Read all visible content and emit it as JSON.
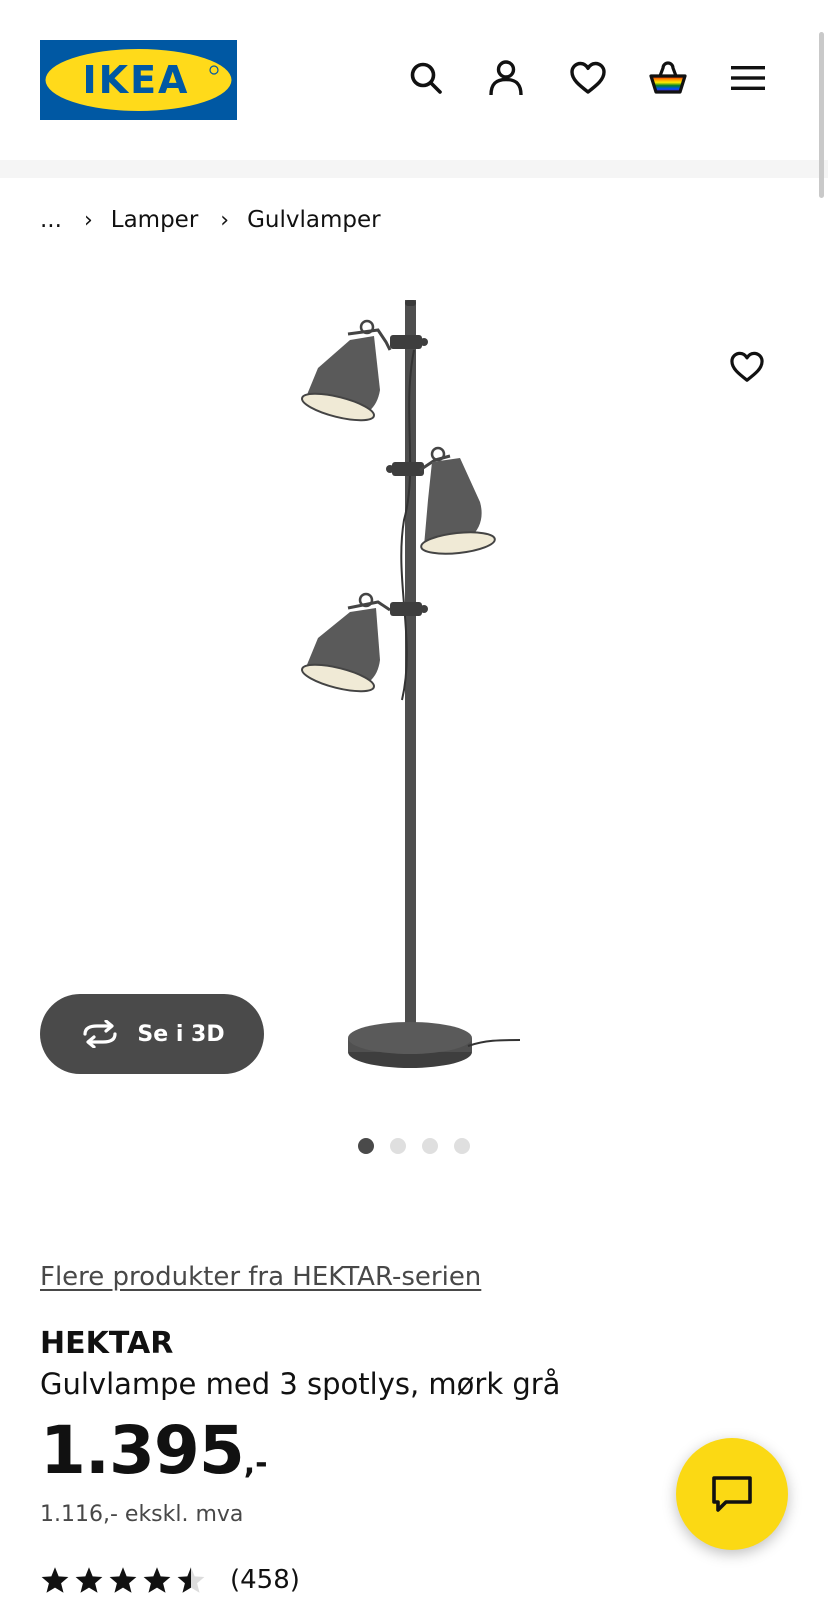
{
  "header": {
    "logo_text": "IKEA",
    "icons": [
      "search-icon",
      "user-icon",
      "heart-icon",
      "basket-icon",
      "menu-icon"
    ],
    "colors": {
      "logo_blue": "#0058a3",
      "logo_yellow": "#ffda1a",
      "accent_yellow": "#fbd914"
    }
  },
  "breadcrumb": {
    "ellipsis": "...",
    "items": [
      "Lamper",
      "Gulvlamper"
    ]
  },
  "gallery": {
    "view_3d_label": "Se i 3D",
    "slides_total": 4,
    "active_slide": 1
  },
  "product": {
    "series_link": "Flere produkter fra HEKTAR-serien",
    "name": "HEKTAR",
    "description": "Gulvlampe med 3 spotlys, mørk grå",
    "price": "1.395",
    "price_suffix": ",-",
    "price_excl_vat": "1.116,- ekskl. mva",
    "rating_value": 4.5,
    "rating_count": "(458)"
  }
}
